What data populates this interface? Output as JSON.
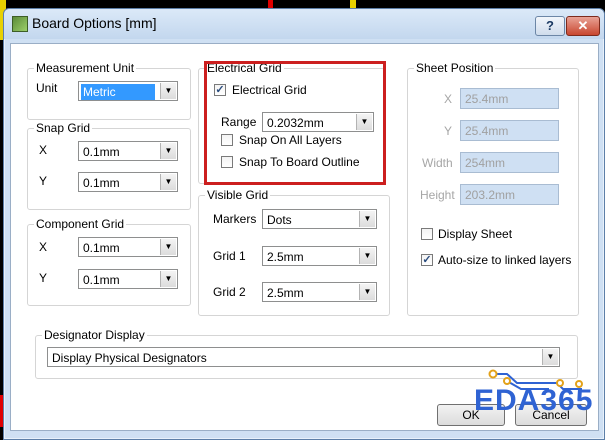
{
  "window": {
    "title": "Board Options [mm]",
    "help_label": "?",
    "close_label": "✕"
  },
  "measurement_unit": {
    "title": "Measurement Unit",
    "unit_label": "Unit",
    "unit_value": "Metric"
  },
  "snap_grid": {
    "title": "Snap Grid",
    "x_label": "X",
    "x_value": "0.1mm",
    "y_label": "Y",
    "y_value": "0.1mm"
  },
  "component_grid": {
    "title": "Component Grid",
    "x_label": "X",
    "x_value": "0.1mm",
    "y_label": "Y",
    "y_value": "0.1mm"
  },
  "electrical_grid": {
    "title": "Electrical Grid",
    "enable_label": "Electrical Grid",
    "enable_checked": "✓",
    "range_label": "Range",
    "range_value": "0.2032mm",
    "snap_all_layers_label": "Snap On All Layers",
    "snap_board_outline_label": "Snap To Board Outline"
  },
  "visible_grid": {
    "title": "Visible Grid",
    "markers_label": "Markers",
    "markers_value": "Dots",
    "grid1_label": "Grid 1",
    "grid1_value": "2.5mm",
    "grid2_label": "Grid 2",
    "grid2_value": "2.5mm"
  },
  "sheet_position": {
    "title": "Sheet Position",
    "x_label": "X",
    "x_value": "25.4mm",
    "y_label": "Y",
    "y_value": "25.4mm",
    "width_label": "Width",
    "width_value": "254mm",
    "height_label": "Height",
    "height_value": "203.2mm",
    "display_sheet_label": "Display Sheet",
    "auto_size_label": "Auto-size to linked layers",
    "auto_size_checked": "✓"
  },
  "designator_display": {
    "title": "Designator Display",
    "value": "Display Physical Designators"
  },
  "buttons": {
    "ok": "OK",
    "cancel": "Cancel"
  },
  "watermark": {
    "text": "EDA365"
  },
  "colors": {
    "highlight": "#cc1f1f",
    "selection": "#3399ff",
    "watermark": "#2f63d3"
  }
}
